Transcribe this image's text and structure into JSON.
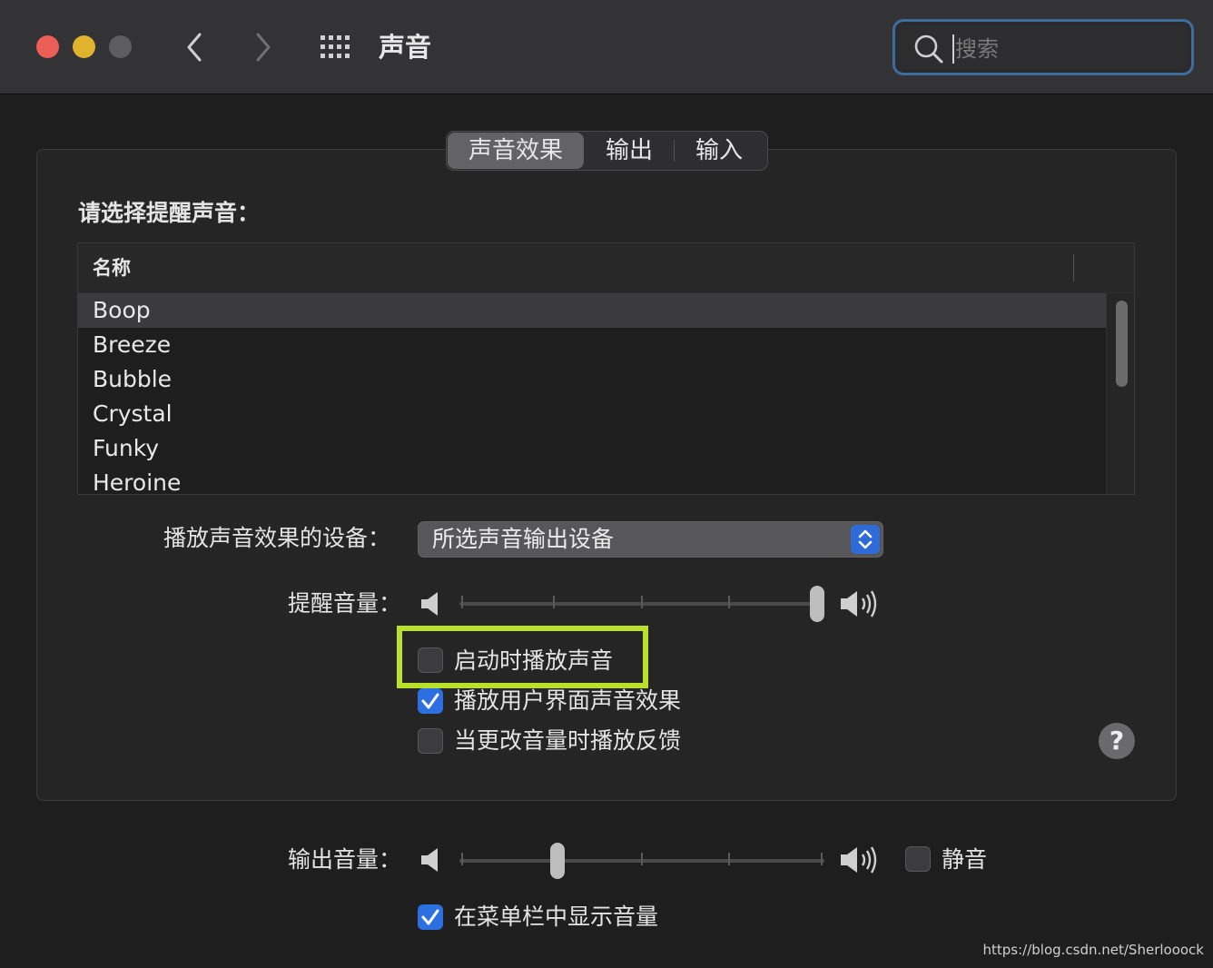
{
  "window": {
    "title": "声音",
    "search_placeholder": "搜索"
  },
  "colors": {
    "close": "#ec5f57",
    "minimize": "#e0b22e",
    "zoom": "#5d5d5f",
    "accent": "#2c6fe0",
    "highlight_box": "#b9e12c"
  },
  "tabs": [
    {
      "label": "声音效果",
      "selected": true
    },
    {
      "label": "输出",
      "selected": false
    },
    {
      "label": "输入",
      "selected": false
    }
  ],
  "alerts": {
    "heading": "请选择提醒声音：",
    "column_name": "名称",
    "sounds": [
      "Boop",
      "Breeze",
      "Bubble",
      "Crystal",
      "Funky",
      "Heroine"
    ],
    "selected": "Boop"
  },
  "device": {
    "label": "播放声音效果的设备：",
    "value": "所选声音输出设备"
  },
  "alert_volume": {
    "label": "提醒音量：",
    "value": 1.0
  },
  "options": {
    "startup": {
      "label": "启动时播放声音",
      "checked": false
    },
    "ui_effects": {
      "label": "播放用户界面声音效果",
      "checked": true
    },
    "feedback": {
      "label": "当更改音量时播放反馈",
      "checked": false
    }
  },
  "help": {
    "label": "?"
  },
  "output_volume": {
    "label": "输出音量：",
    "value": 0.26,
    "mute_label": "静音",
    "mute": false
  },
  "menubar": {
    "label": "在菜单栏中显示音量",
    "checked": true
  },
  "watermark": "https://blog.csdn.net/Sherlooock"
}
